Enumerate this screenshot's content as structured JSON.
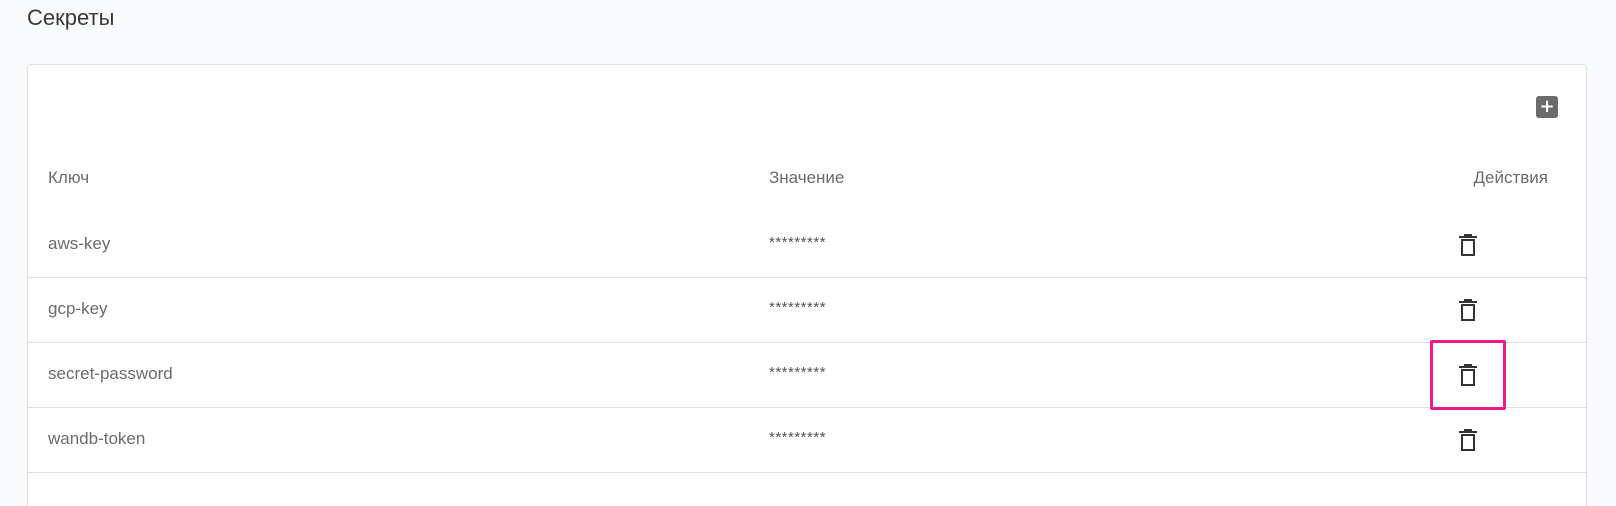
{
  "page": {
    "title": "Секреты"
  },
  "toolbar": {
    "add_icon": "plus-icon"
  },
  "table": {
    "columns": {
      "key": "Ключ",
      "value": "Значение",
      "actions": "Действия"
    },
    "rows": [
      {
        "key": "aws-key",
        "value": "*********",
        "action_icon": "trash-icon"
      },
      {
        "key": "gcp-key",
        "value": "*********",
        "action_icon": "trash-icon"
      },
      {
        "key": "secret-password",
        "value": "*********",
        "action_icon": "trash-icon",
        "highlighted": true
      },
      {
        "key": "wandb-token",
        "value": "*********",
        "action_icon": "trash-icon"
      }
    ]
  },
  "colors": {
    "highlight": "#ee1a8a",
    "icon": "#333333",
    "add_button_bg": "#6b6b6b"
  }
}
